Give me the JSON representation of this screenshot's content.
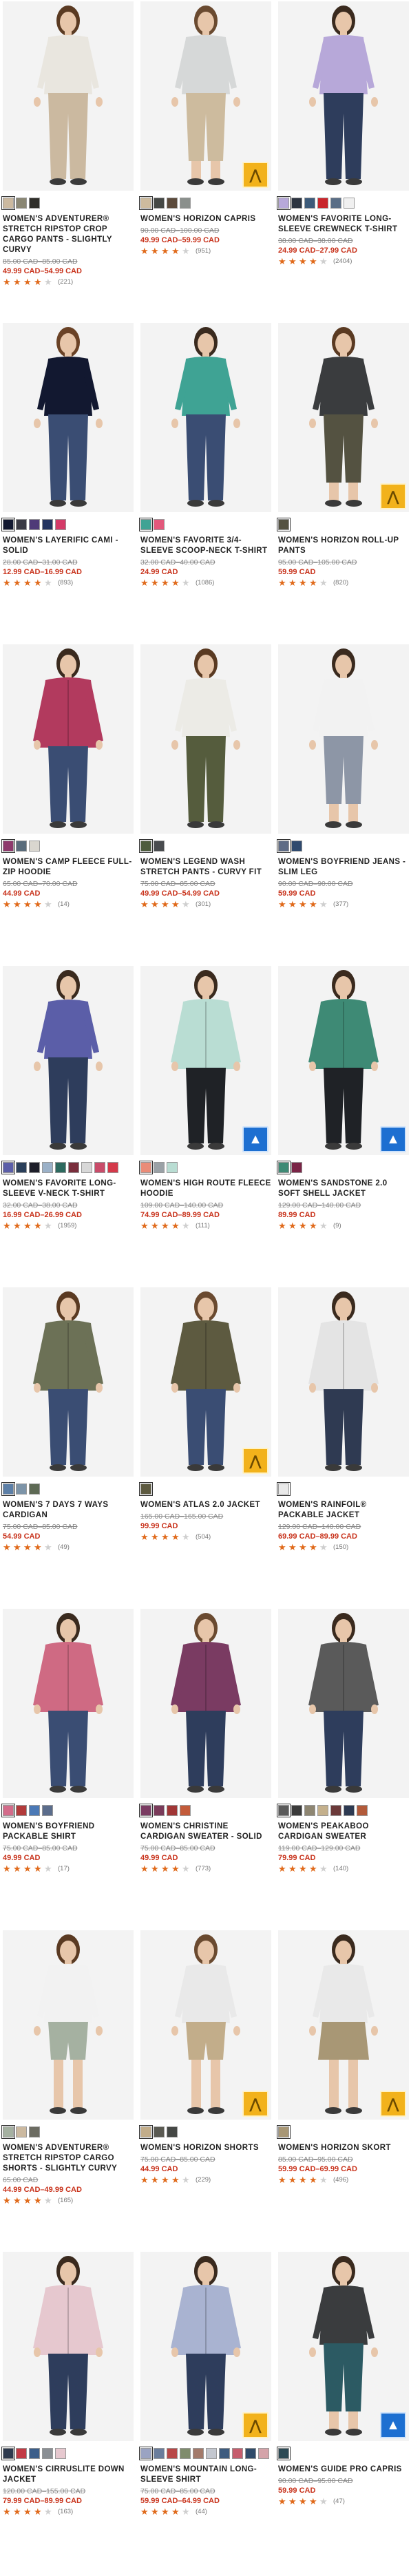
{
  "products": [
    {
      "name": "Women's Adventurer® Stretch Ripstop Crop Cargo Pants - Slightly Curvy",
      "original_price": "85.00 CAD–85.00 CAD",
      "sale_price": "49.99 CAD–54.99 CAD",
      "rating": 4,
      "reviews": "(221)",
      "badge": null,
      "colors": [
        "#cbb9a0",
        "#8a8774",
        "#2f2e2a"
      ],
      "garment": {
        "top": "#e9e6df",
        "bottom": "#cbb9a0",
        "skin": "#e7c6aa",
        "hair": "#5a3a22",
        "type": "pants"
      }
    },
    {
      "name": "Women's Horizon Capris",
      "original_price": "90.00 CAD–100.00 CAD",
      "sale_price": "49.99 CAD–59.99 CAD",
      "rating": 4,
      "reviews": "(951)",
      "badge": "gold",
      "colors": [
        "#cdbb9e",
        "#454845",
        "#5b4a3b",
        "#8a8f8c"
      ],
      "garment": {
        "top": "#d6d8d8",
        "bottom": "#cdbb9e",
        "skin": "#e7c6aa",
        "hair": "#6a4a30",
        "type": "capri"
      }
    },
    {
      "name": "Women's Favorite Long-Sleeve Crewneck T-Shirt",
      "original_price": "38.00 CAD–38.00 CAD",
      "sale_price": "24.99 CAD–27.99 CAD",
      "rating": 4,
      "reviews": "(2404)",
      "badge": null,
      "colors": [
        "#b7a8d9",
        "#2c3440",
        "#3d5b7a",
        "#c9262c",
        "#5a6e86",
        "#f0f0f0"
      ],
      "garment": {
        "top": "#b7a8d9",
        "bottom": "#2e3d5c",
        "skin": "#e7c6aa",
        "hair": "#3a2a1e",
        "type": "pants"
      }
    },
    {
      "name": "Women's Layerific Cami - Solid",
      "original_price": "28.00 CAD–31.00 CAD",
      "sale_price": "12.99 CAD–16.99 CAD",
      "rating": 4,
      "reviews": "(893)",
      "badge": null,
      "colors": [
        "#121830",
        "#3a3a44",
        "#4f3a78",
        "#233460",
        "#d43a67"
      ],
      "garment": {
        "top": "#121830",
        "bottom": "#3a4d73",
        "skin": "#e7c6aa",
        "hair": "#6a4226",
        "type": "pants"
      }
    },
    {
      "name": "Women's Favorite 3/4-Sleeve Scoop-Neck T-Shirt",
      "original_price": "32.00 CAD–40.00 CAD",
      "sale_price": "24.99 CAD",
      "rating": 4,
      "reviews": "(1086)",
      "badge": null,
      "colors": [
        "#3fa394",
        "#e2587b"
      ],
      "garment": {
        "top": "#3fa394",
        "bottom": "#3a4d73",
        "skin": "#e7c6aa",
        "hair": "#3a2a1e",
        "type": "pants"
      }
    },
    {
      "name": "Women's Horizon Roll-Up Pants",
      "original_price": "95.00 CAD–105.00 CAD",
      "sale_price": "59.99 CAD",
      "rating": 4,
      "reviews": "(820)",
      "badge": "gold",
      "colors": [
        "#545241"
      ],
      "garment": {
        "top": "#3a3c3e",
        "bottom": "#545241",
        "skin": "#e7c6aa",
        "hair": "#5a3a22",
        "type": "capri"
      }
    },
    {
      "name": "Women's Camp Fleece Full-Zip Hoodie",
      "original_price": "65.00 CAD–70.00 CAD",
      "sale_price": "44.99 CAD",
      "rating": 4,
      "reviews": "(14)",
      "badge": null,
      "colors": [
        "#8e3a6c",
        "#5a6c7b",
        "#d9d6cf"
      ],
      "garment": {
        "top": "#b23a5e",
        "bottom": "#3a4d73",
        "skin": "#e7c6aa",
        "hair": "#3a2a1e",
        "type": "hoodie"
      }
    },
    {
      "name": "Women's Legend Wash Stretch Pants - Curvy Fit",
      "original_price": "75.00 CAD–85.00 CAD",
      "sale_price": "49.99 CAD–54.99 CAD",
      "rating": 4,
      "reviews": "(301)",
      "badge": null,
      "colors": [
        "#4e5c3e",
        "#4a4c4f"
      ],
      "garment": {
        "top": "#ecebe6",
        "bottom": "#555c3d",
        "skin": "#e7c6aa",
        "hair": "#5a3a22",
        "type": "pants"
      }
    },
    {
      "name": "Women's Boyfriend Jeans - Slim Leg",
      "original_price": "90.00 CAD–90.00 CAD",
      "sale_price": "59.99 CAD",
      "rating": 4,
      "reviews": "(377)",
      "badge": null,
      "colors": [
        "#5f6c86",
        "#2f4a6e"
      ],
      "garment": {
        "top": "#f2f2f2",
        "bottom": "#8d96a6",
        "skin": "#e7c6aa",
        "hair": "#3a2a1e",
        "type": "capri"
      }
    },
    {
      "name": "Women's Favorite Long-Sleeve V-Neck T-Shirt",
      "original_price": "32.00 CAD–38.00 CAD",
      "sale_price": "16.99 CAD–26.99 CAD",
      "rating": 4,
      "reviews": "(1959)",
      "badge": null,
      "colors": [
        "#5b5ea8",
        "#2a3f5a",
        "#1e1f2a",
        "#9bb1c8",
        "#2d6a5f",
        "#7a2d3c",
        "#d8d8d8",
        "#c94c6a",
        "#d4394a"
      ],
      "garment": {
        "top": "#5b5ea8",
        "bottom": "#2e3d5c",
        "skin": "#e7c6aa",
        "hair": "#3a2a1e",
        "type": "pants"
      }
    },
    {
      "name": "Women's High Route Fleece Hoodie",
      "original_price": "109.00 CAD–140.00 CAD",
      "sale_price": "74.99 CAD–89.99 CAD",
      "rating": 4,
      "reviews": "(111)",
      "badge": "blue",
      "colors": [
        "#ea8c78",
        "#9aa1a6",
        "#b9ddd3"
      ],
      "garment": {
        "top": "#b9ddd3",
        "bottom": "#1f2226",
        "skin": "#e7c6aa",
        "hair": "#3a2a1e",
        "type": "hoodie"
      }
    },
    {
      "name": "Women's Sandstone 2.0 Soft Shell Jacket",
      "original_price": "129.00 CAD–140.00 CAD",
      "sale_price": "89.99 CAD",
      "rating": 4,
      "reviews": "(9)",
      "badge": "blue",
      "colors": [
        "#3e8a75",
        "#7a2446"
      ],
      "garment": {
        "top": "#3e8a75",
        "bottom": "#1f2226",
        "skin": "#e7c6aa",
        "hair": "#3a2a1e",
        "type": "hoodie"
      }
    },
    {
      "name": "Women's 7 Days 7 Ways Cardigan",
      "original_price": "75.00 CAD–85.00 CAD",
      "sale_price": "54.99 CAD",
      "rating": 4,
      "reviews": "(49)",
      "badge": null,
      "colors": [
        "#5c7fa7",
        "#7d94a8",
        "#5e6a55"
      ],
      "garment": {
        "top": "#6c7156",
        "bottom": "#3a4d73",
        "skin": "#e7c6aa",
        "hair": "#5a3a22",
        "type": "cardigan"
      }
    },
    {
      "name": "Women's Atlas 2.0 Jacket",
      "original_price": "165.00 CAD–165.00 CAD",
      "sale_price": "99.99 CAD",
      "rating": 4,
      "reviews": "(504)",
      "badge": "gold",
      "colors": [
        "#5d5a40"
      ],
      "garment": {
        "top": "#5d5a40",
        "bottom": "#3a4d73",
        "skin": "#e7c6aa",
        "hair": "#6a4a30",
        "type": "jacket"
      }
    },
    {
      "name": "Women's Rainfoil® Packable Jacket",
      "original_price": "129.00 CAD–140.00 CAD",
      "sale_price": "69.99 CAD–89.99 CAD",
      "rating": 4,
      "reviews": "(150)",
      "badge": null,
      "colors": [
        "#e9e9e9"
      ],
      "garment": {
        "top": "#e4e4e4",
        "bottom": "#2f3a52",
        "skin": "#e7c6aa",
        "hair": "#3a2a1e",
        "type": "hoodie"
      }
    },
    {
      "name": "Women's Boyfriend Packable Shirt",
      "original_price": "75.00 CAD–85.00 CAD",
      "sale_price": "49.99 CAD",
      "rating": 4,
      "reviews": "(17)",
      "badge": null,
      "colors": [
        "#d36b8a",
        "#b23b3b",
        "#4b79b6",
        "#5b6d8c"
      ],
      "garment": {
        "top": "#cf6a83",
        "bottom": "#3a4d73",
        "skin": "#e7c6aa",
        "hair": "#3a2a1e",
        "type": "shirt"
      }
    },
    {
      "name": "Women's Christine Cardigan Sweater - Solid",
      "original_price": "75.00 CAD–85.00 CAD",
      "sale_price": "49.99 CAD",
      "rating": 4,
      "reviews": "(773)",
      "badge": null,
      "colors": [
        "#7a3b62",
        "#7a3b5a",
        "#a13636",
        "#c35b3a"
      ],
      "garment": {
        "top": "#7a3b62",
        "bottom": "#2e3d5c",
        "skin": "#e7c6aa",
        "hair": "#6a4a30",
        "type": "cardigan"
      }
    },
    {
      "name": "Women's Peakaboo Cardigan Sweater",
      "original_price": "119.00 CAD–129.00 CAD",
      "sale_price": "79.99 CAD",
      "rating": 4,
      "reviews": "(140)",
      "badge": null,
      "colors": [
        "#5a5a5a",
        "#3a3a3a",
        "#8e8672",
        "#c4b08c",
        "#6b3a3a",
        "#2d3a52",
        "#b25a3a"
      ],
      "garment": {
        "top": "#5a5a5a",
        "bottom": "#2e3d5c",
        "skin": "#e7c6aa",
        "hair": "#3a2a1e",
        "type": "cardigan"
      }
    },
    {
      "name": "Women's Adventurer® Stretch Ripstop Cargo Shorts - Slightly Curvy",
      "original_price": "65.00 CAD",
      "sale_price": "44.99 CAD–49.99 CAD",
      "rating": 4,
      "reviews": "(165)",
      "badge": null,
      "colors": [
        "#a5b1a1",
        "#cbb9a0",
        "#6c6c62"
      ],
      "garment": {
        "top": "#f2f2f2",
        "bottom": "#a5b1a1",
        "skin": "#e7c6aa",
        "hair": "#5a3a22",
        "type": "shorts"
      }
    },
    {
      "name": "Women's Horizon Shorts",
      "original_price": "75.00 CAD–85.00 CAD",
      "sale_price": "44.99 CAD",
      "rating": 4,
      "reviews": "(229)",
      "badge": "gold",
      "colors": [
        "#c2ad8a",
        "#5a5a52",
        "#454845"
      ],
      "garment": {
        "top": "#e9e9e9",
        "bottom": "#c2ad8a",
        "skin": "#e7c6aa",
        "hair": "#6a4a30",
        "type": "shorts"
      }
    },
    {
      "name": "Women's Horizon Skort",
      "original_price": "85.00 CAD–95.00 CAD",
      "sale_price": "59.99 CAD–69.99 CAD",
      "rating": 4,
      "reviews": "(496)",
      "badge": "gold",
      "colors": [
        "#a89775"
      ],
      "garment": {
        "top": "#e9e9e9",
        "bottom": "#a89775",
        "skin": "#e7c6aa",
        "hair": "#3a2a1e",
        "type": "skort"
      }
    },
    {
      "name": "Women's CirrusLite Down Jacket",
      "original_price": "120.00 CAD–155.00 CAD",
      "sale_price": "79.99 CAD–89.99 CAD",
      "rating": 4,
      "reviews": "(163)",
      "badge": null,
      "colors": [
        "#2e3a4e",
        "#c23a44",
        "#3b5e8a",
        "#8a8f94",
        "#e6c8cf"
      ],
      "garment": {
        "top": "#e6c8cf",
        "bottom": "#2e3d5c",
        "skin": "#e7c6aa",
        "hair": "#3a2a1e",
        "type": "jacket"
      }
    },
    {
      "name": "Women's Mountain Long-Sleeve Shirt",
      "original_price": "75.00 CAD–85.00 CAD",
      "sale_price": "59.99 CAD–64.99 CAD",
      "rating": 4,
      "reviews": "(44)",
      "badge": "gold",
      "colors": [
        "#9aa3c2",
        "#6a7d9c",
        "#b84848",
        "#7f8c6d",
        "#a37a6b",
        "#c3c7cf",
        "#3e5c7f",
        "#c65d6d",
        "#2f4b6a",
        "#d4a3a9"
      ],
      "garment": {
        "top": "#a9b3d1",
        "bottom": "#2e3d5c",
        "skin": "#e7c6aa",
        "hair": "#3a2a1e",
        "type": "shirt"
      }
    },
    {
      "name": "Women's Guide Pro Capris",
      "original_price": "90.00 CAD–95.00 CAD",
      "sale_price": "59.99 CAD",
      "rating": 4,
      "reviews": "(47)",
      "badge": "blue",
      "colors": [
        "#2c4a55"
      ],
      "garment": {
        "top": "#3a3c3e",
        "bottom": "#2c5a63",
        "skin": "#e7c6aa",
        "hair": "#3a2a1e",
        "type": "capri"
      }
    }
  ],
  "star_glyph": "★",
  "badge_gold_glyph": "⋀",
  "badge_blue_glyph": "▲"
}
